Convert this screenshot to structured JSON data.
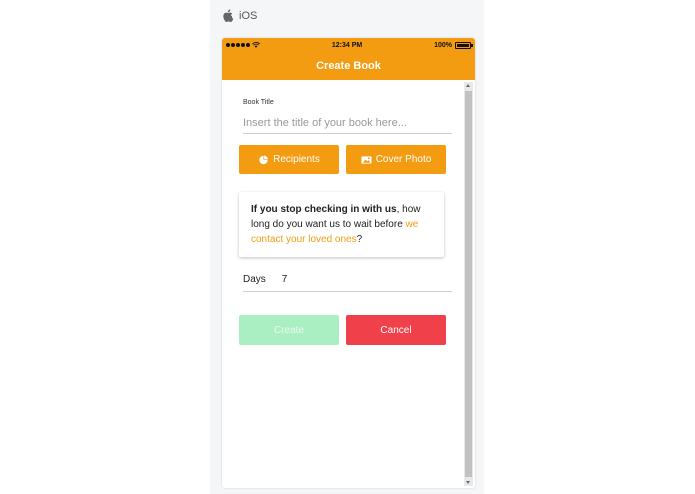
{
  "platform": {
    "label": "iOS",
    "icon": "apple-icon"
  },
  "statusbar": {
    "time": "12:34 PM",
    "battery": "100%",
    "signal_icon": "signal-dots-icon",
    "wifi_icon": "wifi-icon",
    "battery_icon": "battery-icon"
  },
  "navbar": {
    "title": "Create Book"
  },
  "form": {
    "title_label": "Book Title",
    "title_placeholder": "Insert the title of your book here...",
    "title_value": ""
  },
  "buttons": {
    "recipients": {
      "label": "Recipients",
      "icon": "pie-chart-icon"
    },
    "cover_photo": {
      "label": "Cover Photo",
      "icon": "image-icon"
    },
    "create": "Create",
    "cancel": "Cancel"
  },
  "info_card": {
    "bold": "If you stop checking in with us",
    "text": ", how long do you want us to wait before",
    "highlight": "we contact your loved ones",
    "end": "?"
  },
  "days": {
    "label": "Days",
    "value": "7"
  },
  "colors": {
    "accent": "#f39c12",
    "create_disabled": "#aaefc2",
    "cancel": "#f0404a"
  }
}
